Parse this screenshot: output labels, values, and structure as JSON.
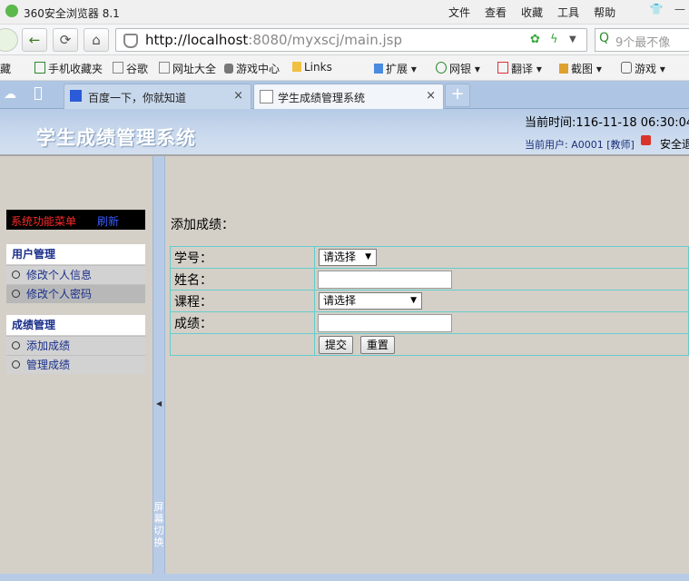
{
  "browser": {
    "title": "360安全浏览器 8.1",
    "menus": [
      "文件",
      "查看",
      "收藏",
      "工具",
      "帮助"
    ],
    "url_host": "http://localhost",
    "url_rest": ":8080/myxscj/main.jsp",
    "search_placeholder": "9个最不像",
    "bookmarks": [
      "藏",
      "手机收藏夹",
      "谷歌",
      "网址大全",
      "游戏中心",
      "Links",
      "扩展",
      "网银",
      "翻译",
      "截图",
      "游戏"
    ],
    "tabs": [
      {
        "label": "百度一下，你就知道"
      },
      {
        "label": "学生成绩管理系统"
      }
    ]
  },
  "header": {
    "system_title": "学生成绩管理系统",
    "current_time": "当前时间:116-11-18 06:30:04",
    "current_user": "当前用户: A0001 [教师]",
    "logout_label": "安全退出"
  },
  "menu": {
    "title": "系统功能菜单",
    "refresh": "刷新",
    "groups": [
      {
        "title": "用户管理",
        "items": [
          "修改个人信息",
          "修改个人密码"
        ]
      },
      {
        "title": "成绩管理",
        "items": [
          "添加成绩",
          "管理成绩"
        ]
      }
    ]
  },
  "splitter": {
    "label": "屏幕切换"
  },
  "form": {
    "title": "添加成绩：",
    "student_id_label": "学号：",
    "student_id_value": "请选择",
    "name_label": "姓名：",
    "name_value": "",
    "course_label": "课程：",
    "course_value": "请选择",
    "score_label": "成绩：",
    "score_value": "",
    "submit_label": "提交",
    "reset_label": "重置"
  }
}
